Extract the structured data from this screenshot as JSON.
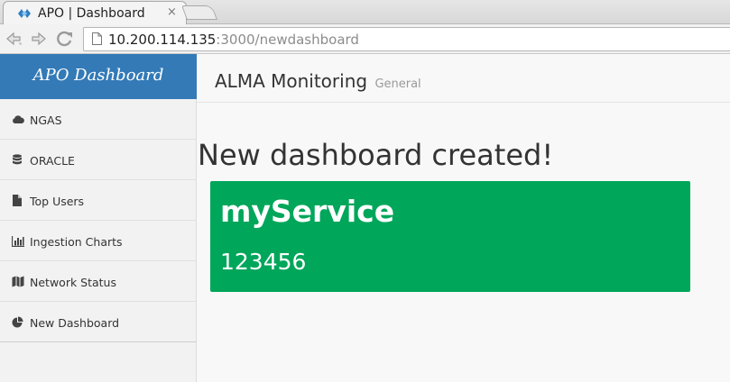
{
  "browser": {
    "tab_title": "APO | Dashboard",
    "tab_close": "×",
    "url_host": "10.200.114.135",
    "url_rest": ":3000/newdashboard"
  },
  "sidebar": {
    "brand": "APO Dashboard",
    "items": [
      {
        "label": "NGAS",
        "icon": "cloud-icon"
      },
      {
        "label": "ORACLE",
        "icon": "database-icon"
      },
      {
        "label": "Top Users",
        "icon": "file-icon"
      },
      {
        "label": "Ingestion Charts",
        "icon": "bar-chart-icon"
      },
      {
        "label": "Network Status",
        "icon": "map-icon"
      },
      {
        "label": "New Dashboard",
        "icon": "pie-chart-icon"
      }
    ]
  },
  "header": {
    "title": "ALMA Monitoring",
    "subtitle": "General"
  },
  "main": {
    "message": "New dashboard created!",
    "service_card": {
      "name": "myService",
      "value": "123456"
    }
  },
  "colors": {
    "brand_blue": "#337ab7",
    "card_green": "#00a65a"
  }
}
